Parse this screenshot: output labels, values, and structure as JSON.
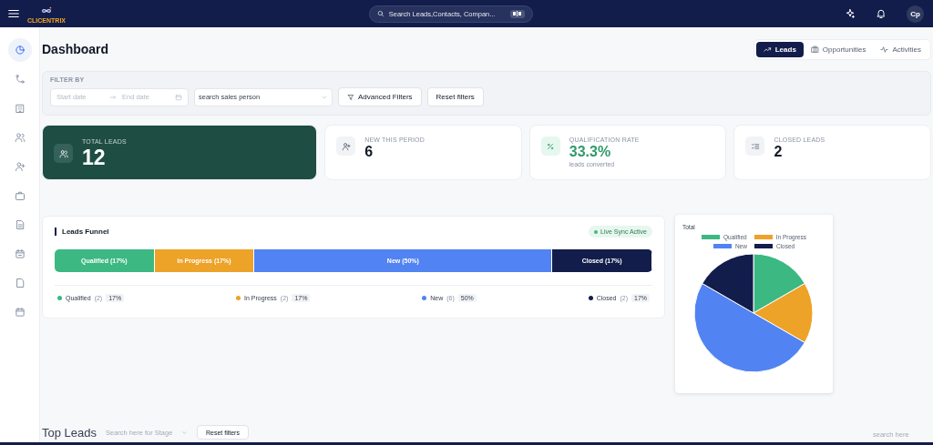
{
  "topbar": {
    "logo": "CLICENTRIX",
    "search": {
      "placeholder": "Search Leads,Contacts, Compan..."
    },
    "avatar": "Cp"
  },
  "sidebar": {
    "items": [
      {
        "selected": true
      },
      {
        "selected": false
      },
      {
        "selected": false
      },
      {
        "selected": false
      },
      {
        "selected": false
      },
      {
        "selected": false
      },
      {
        "selected": false
      },
      {
        "selected": false
      },
      {
        "selected": false
      },
      {
        "selected": false
      }
    ]
  },
  "title": "Dashboard",
  "tabs": [
    {
      "label": "Leads",
      "selected": true
    },
    {
      "label": "Opportunities",
      "selected": false
    },
    {
      "label": "Activities",
      "selected": false
    }
  ],
  "filters": {
    "label": "FILTER BY",
    "start_date": {
      "placeholder": "Start date"
    },
    "end_date": {
      "placeholder": "End date"
    },
    "sales_person": {
      "placeholder": "search sales person"
    },
    "buttons": [
      "Advanced Filters",
      "Reset filters"
    ]
  },
  "stats": [
    {
      "label": "TOTAL LEADS",
      "value": "12",
      "highlight": true
    },
    {
      "label": "NEW THIS PERIOD",
      "value": "6",
      "highlight": false
    },
    {
      "label": "QUALIFICATION RATE",
      "value": "33.3%",
      "note": "leads converted",
      "highlight": false
    },
    {
      "label": "CLOSED LEADS",
      "value": "2",
      "highlight": false
    }
  ],
  "funnel": {
    "title": "Leads Funnel",
    "badge": "Live Sync Active",
    "segments": [
      {
        "label": "Qualified (17%)",
        "color": "#3cb882"
      },
      {
        "label": "In Progress (17%)",
        "color": "#eda228"
      },
      {
        "label": "New (50%)",
        "color": "#5183f2"
      },
      {
        "label": "Closed (17%)",
        "color": "#121d4b"
      }
    ],
    "legend": [
      {
        "name": "Qualified",
        "count": "(2)",
        "percent": "17%",
        "color": "#3cb882"
      },
      {
        "name": "In Progress",
        "count": "(2)",
        "percent": "17%",
        "color": "#eda228"
      },
      {
        "name": "New",
        "count": "(6)",
        "percent": "50%",
        "color": "#5183f2"
      },
      {
        "name": "Closed",
        "count": "(2)",
        "percent": "17%",
        "color": "#121d4b"
      }
    ]
  },
  "pie": {
    "chart_data": {
      "type": "pie",
      "title": "Total",
      "legend": "top",
      "categories": [
        "Qualified",
        "In Progress",
        "New",
        "Closed"
      ],
      "values": [
        16.67,
        16.67,
        50,
        16.66
      ],
      "colors": [
        "#3cb882",
        "#eda228",
        "#5183f2",
        "#121d4b"
      ]
    }
  },
  "top_leads": {
    "title": "Top Leads",
    "stage_search": {
      "placeholder": "Search here for Stage"
    },
    "button": "Reset filters",
    "search": {
      "placeholder": "search here"
    }
  }
}
